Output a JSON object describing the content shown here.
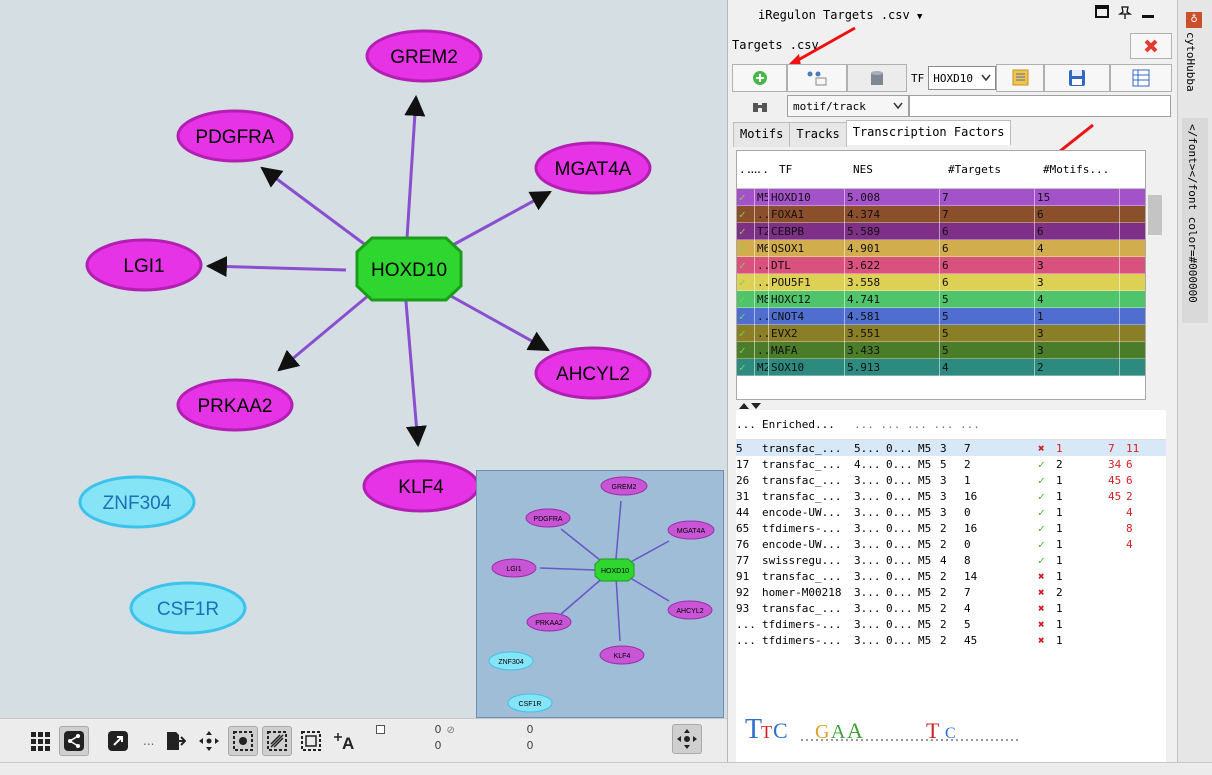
{
  "network": {
    "hub": "HOXD10",
    "targets": [
      "GREM2",
      "PDGFRA",
      "MGAT4A",
      "LGI1",
      "AHCYL2",
      "PRKAA2",
      "KLF4"
    ],
    "other_nodes": [
      "ZNF304",
      "CSF1R"
    ]
  },
  "overview": {
    "hub": "HOXD10",
    "targets": [
      "GREM2",
      "PDGFRA",
      "MGAT4A",
      "LGI1",
      "AHCYL2",
      "PRKAA2",
      "KLF4"
    ],
    "other_nodes": [
      "ZNF304",
      "CSF1R"
    ]
  },
  "toolbar": {
    "dots": "...",
    "counter1_top": "0",
    "counter1_bottom": "0",
    "counter2_top": "0",
    "counter2_bottom": "0"
  },
  "panel": {
    "title": "iRegulon Targets .csv",
    "dropdown_glyph": "▼",
    "sub_title": "Targets .csv",
    "tf_label": "TF",
    "tf_value": "HOXD10",
    "filter_value": "motif/track",
    "tabs": [
      "Motifs",
      "Tracks",
      "Transcription Factors"
    ],
    "tf_headers": [
      "...",
      "...",
      "TF",
      "NES",
      "#Targets",
      "#Motifs..."
    ],
    "tf_rows": [
      {
        "rank": "M5",
        "tf": "HOXD10",
        "nes": "5.008",
        "targets": "7",
        "motifs": "15",
        "color": "#a352c9"
      },
      {
        "rank": "...",
        "tf": "FOXA1",
        "nes": "4.374",
        "targets": "7",
        "motifs": "6",
        "color": "#8c4f2b"
      },
      {
        "rank": "T2",
        "tf": "CEBPB",
        "nes": "5.589",
        "targets": "6",
        "motifs": "6",
        "color": "#7e2f86"
      },
      {
        "rank": "M6",
        "tf": "QSOX1",
        "nes": "4.901",
        "targets": "6",
        "motifs": "4",
        "color": "#d2ad4e"
      },
      {
        "rank": "...",
        "tf": "DTL",
        "nes": "3.622",
        "targets": "6",
        "motifs": "3",
        "color": "#d9517d"
      },
      {
        "rank": "...",
        "tf": "POU5F1",
        "nes": "3.558",
        "targets": "6",
        "motifs": "3",
        "color": "#dcd055"
      },
      {
        "rank": "M8",
        "tf": "HOXC12",
        "nes": "4.741",
        "targets": "5",
        "motifs": "4",
        "color": "#4fc46a"
      },
      {
        "rank": "...",
        "tf": "CNOT4",
        "nes": "4.581",
        "targets": "5",
        "motifs": "1",
        "color": "#4f6ecf"
      },
      {
        "rank": "...",
        "tf": "EVX2",
        "nes": "3.551",
        "targets": "5",
        "motifs": "3",
        "color": "#8a7e27"
      },
      {
        "rank": "...",
        "tf": "MAFA",
        "nes": "3.433",
        "targets": "5",
        "motifs": "3",
        "color": "#4a7c2a"
      },
      {
        "rank": "M2",
        "tf": "SOX10",
        "nes": "5.913",
        "targets": "4",
        "motifs": "2",
        "color": "#2c8a7f"
      }
    ],
    "lower_header": "Enriched...",
    "lower_rows": [
      {
        "n": "5",
        "name": "transfac_...",
        "a": "5...",
        "b": "0...",
        "c": "M5",
        "d": "3",
        "e": "7",
        "ok": false,
        "f": "1",
        "g": "7",
        "h": "11"
      },
      {
        "n": "17",
        "name": "transfac_...",
        "a": "4...",
        "b": "0...",
        "c": "M5",
        "d": "5",
        "e": "2",
        "ok": true,
        "f": "2",
        "g": "34",
        "h": "6"
      },
      {
        "n": "26",
        "name": "transfac_...",
        "a": "3...",
        "b": "0...",
        "c": "M5",
        "d": "3",
        "e": "1",
        "ok": true,
        "f": "1",
        "g": "45",
        "h": "6"
      },
      {
        "n": "31",
        "name": "transfac_...",
        "a": "3...",
        "b": "0...",
        "c": "M5",
        "d": "3",
        "e": "16",
        "ok": true,
        "f": "1",
        "g": "45",
        "h": "2"
      },
      {
        "n": "44",
        "name": "encode-UW...",
        "a": "3...",
        "b": "0...",
        "c": "M5",
        "d": "3",
        "e": "0",
        "ok": true,
        "f": "1",
        "g": "",
        "h": "4"
      },
      {
        "n": "65",
        "name": "tfdimers-...",
        "a": "3...",
        "b": "0...",
        "c": "M5",
        "d": "2",
        "e": "16",
        "ok": true,
        "f": "1",
        "g": "",
        "h": "8"
      },
      {
        "n": "76",
        "name": "encode-UW...",
        "a": "3...",
        "b": "0...",
        "c": "M5",
        "d": "2",
        "e": "0",
        "ok": true,
        "f": "1",
        "g": "",
        "h": "4"
      },
      {
        "n": "77",
        "name": "swissregu...",
        "a": "3...",
        "b": "0...",
        "c": "M5",
        "d": "4",
        "e": "8",
        "ok": true,
        "f": "1",
        "g": "",
        "h": ""
      },
      {
        "n": "91",
        "name": "transfac_...",
        "a": "3...",
        "b": "0...",
        "c": "M5",
        "d": "2",
        "e": "14",
        "ok": false,
        "f": "1",
        "g": "",
        "h": ""
      },
      {
        "n": "92",
        "name": "homer-M00218",
        "a": "3...",
        "b": "0...",
        "c": "M5",
        "d": "2",
        "e": "7",
        "ok": false,
        "f": "2",
        "g": "",
        "h": ""
      },
      {
        "n": "93",
        "name": "transfac_...",
        "a": "3...",
        "b": "0...",
        "c": "M5",
        "d": "2",
        "e": "4",
        "ok": false,
        "f": "1",
        "g": "",
        "h": ""
      },
      {
        "n": "...",
        "name": "tfdimers-...",
        "a": "3...",
        "b": "0...",
        "c": "M5",
        "d": "2",
        "e": "5",
        "ok": false,
        "f": "1",
        "g": "",
        "h": ""
      },
      {
        "n": "...",
        "name": "tfdimers-...",
        "a": "3...",
        "b": "0...",
        "c": "M5",
        "d": "2",
        "e": "45",
        "ok": false,
        "f": "1",
        "g": "",
        "h": ""
      }
    ]
  },
  "side_strip": {
    "tab1": "cytoHubba",
    "tab2": "</font></font color=#000000"
  },
  "colors": {
    "target_node": "#e533e5",
    "hub_node": "#2fd62f",
    "edge": "#8a4fd0",
    "isolated_node": "#86e4f7"
  }
}
